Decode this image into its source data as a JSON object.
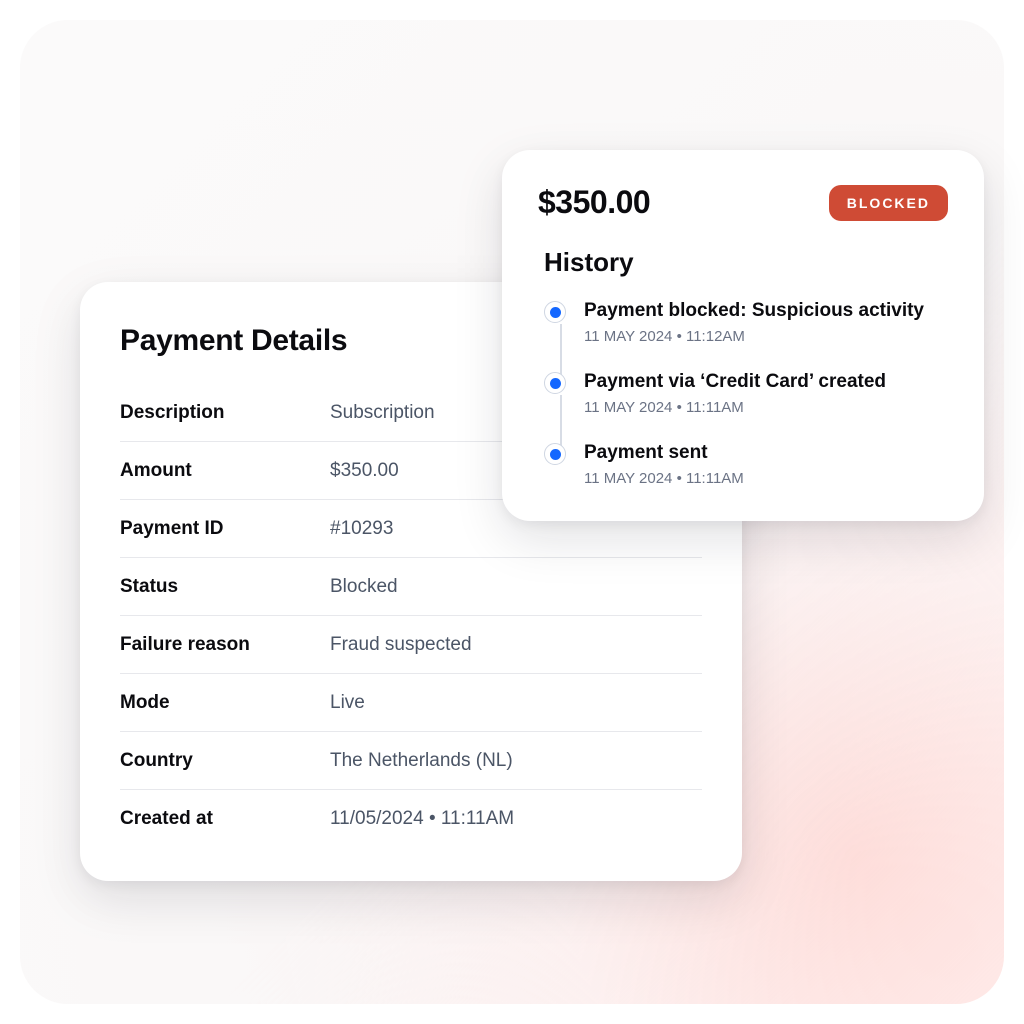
{
  "details": {
    "title": "Payment Details",
    "rows": [
      {
        "label": "Description",
        "value": "Subscription"
      },
      {
        "label": "Amount",
        "value": "$350.00"
      },
      {
        "label": "Payment ID",
        "value": "#10293"
      },
      {
        "label": "Status",
        "value": "Blocked"
      },
      {
        "label": "Failure reason",
        "value": "Fraud suspected"
      },
      {
        "label": "Mode",
        "value": "Live"
      },
      {
        "label": "Country",
        "value": "The Netherlands (NL)"
      },
      {
        "label": "Created at",
        "value": "11/05/2024 • 11:11AM"
      }
    ]
  },
  "history": {
    "amount": "$350.00",
    "status_badge": "BLOCKED",
    "title": "History",
    "items": [
      {
        "title": "Payment blocked: Suspicious activity",
        "time": "11 MAY 2024 • 11:12AM"
      },
      {
        "title": "Payment via ‘Credit Card’ created",
        "time": "11 MAY 2024 • 11:11AM"
      },
      {
        "title": "Payment sent",
        "time": "11 MAY 2024 • 11:11AM"
      }
    ]
  }
}
